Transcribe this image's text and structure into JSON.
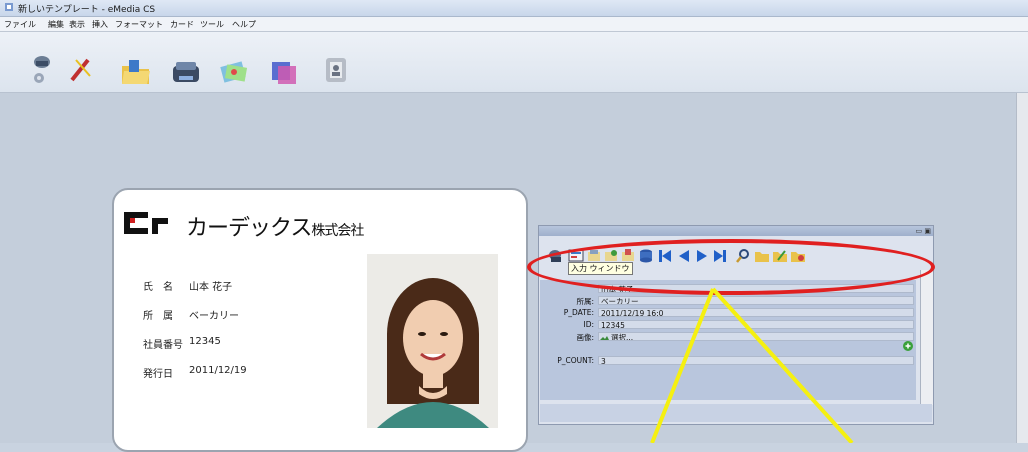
{
  "window": {
    "title": "新しいテンプレート - eMedia CS"
  },
  "menu": {
    "items": [
      "ファイル",
      "編集",
      "表示",
      "挿入",
      "フォーマット",
      "カード",
      "ツール",
      "ヘルプ"
    ]
  },
  "toolbar": {
    "buttons": [
      {
        "icon": "printer-setup-icon"
      },
      {
        "icon": "card-printer-icon"
      },
      {
        "icon": "open-folder-icon"
      },
      {
        "icon": "print-icon"
      },
      {
        "icon": "card-design-icon"
      },
      {
        "icon": "layer-icon"
      },
      {
        "icon": "id-badge-icon"
      }
    ]
  },
  "card": {
    "logo": "Cr",
    "company": "カーデックス",
    "company_suffix": "株式会社",
    "rows": [
      {
        "label": "氏　名",
        "value": "山本 花子"
      },
      {
        "label": "所　属",
        "value": "ベーカリー"
      },
      {
        "label": "社員番号",
        "value": "12345"
      },
      {
        "label": "発行日",
        "value": "2011/12/19"
      }
    ]
  },
  "panel": {
    "tooltip": "入力 ウィンドウ",
    "fields": [
      {
        "label": "",
        "value": "山本 花子"
      },
      {
        "label": "所属:",
        "value": "ベーカリー"
      },
      {
        "label": "P_DATE:",
        "value": "2011/12/19 16:0"
      },
      {
        "label": "ID:",
        "value": "12345"
      },
      {
        "label": "画像:",
        "value": "選択..."
      },
      {
        "label": "P_COUNT:",
        "value": "3"
      }
    ]
  },
  "colors": {
    "highlight": "#e02020",
    "arrow": "#ffff00",
    "workspace": "#c4cedb"
  }
}
